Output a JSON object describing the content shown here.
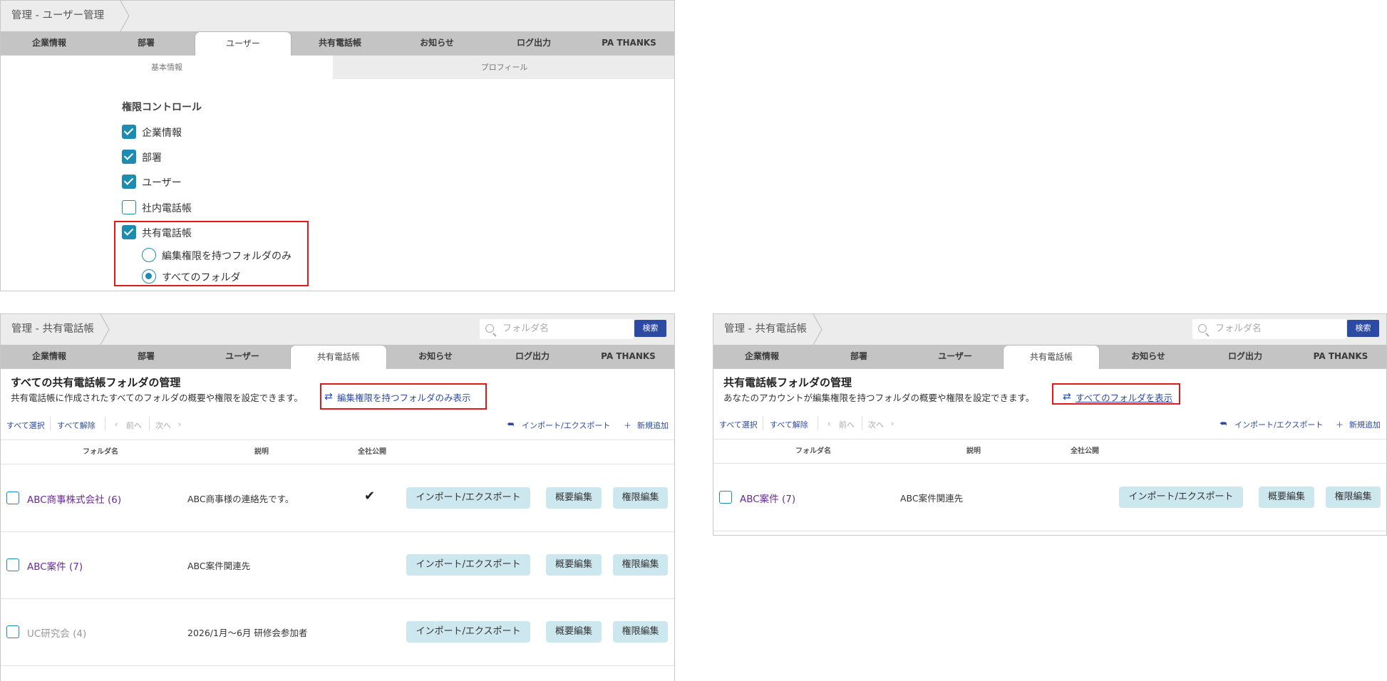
{
  "tab_labels": [
    "企業情報",
    "部署",
    "ユーザー",
    "共有電話帳",
    "お知らせ",
    "ログ出力",
    "PA THANKS"
  ],
  "panel1": {
    "breadcrumb": "管理 - ユーザー管理",
    "subtabs": [
      "基本情報",
      "プロフィール"
    ],
    "perm_title": "権限コントロール",
    "perms": [
      {
        "label": "企業情報",
        "checked": true
      },
      {
        "label": "部署",
        "checked": true
      },
      {
        "label": "ユーザー",
        "checked": true
      },
      {
        "label": "社内電話帳",
        "checked": false
      },
      {
        "label": "共有電話帳",
        "checked": true
      }
    ],
    "radios": [
      {
        "label": "編集権限を持つフォルダのみ",
        "selected": false
      },
      {
        "label": "すべてのフォルダ",
        "selected": true
      }
    ]
  },
  "panel2": {
    "breadcrumb": "管理 - 共有電話帳",
    "search_placeholder": "フォルダ名",
    "search_button": "検索",
    "title": "すべての共有電話帳フォルダの管理",
    "desc": "共有電話帳に作成されたすべてのフォルダの概要や権限を設定できます。",
    "link": "編集権限を持つフォルダのみ表示",
    "toolbar": {
      "select_all": "すべて選択",
      "deselect_all": "すべて解除",
      "prev": "前へ",
      "next": "次へ",
      "import_export": "インポート/エクスポート",
      "add_new": "新規追加"
    },
    "columns": [
      "フォルダ名",
      "説明",
      "全社公開"
    ],
    "rows": [
      {
        "name": "ABC商事株式会社 (6)",
        "desc": "ABC商事様の連絡先です。",
        "public": "✔",
        "name_gray": false
      },
      {
        "name": "ABC案件 (7)",
        "desc": "ABC案件関連先",
        "public": "",
        "name_gray": false
      },
      {
        "name": "UC研究会 (4)",
        "desc": "2026/1月～6月 研修会参加者",
        "public": "",
        "name_gray": true
      }
    ],
    "row_buttons": [
      "インポート/エクスポート",
      "概要編集",
      "権限編集"
    ]
  },
  "panel3": {
    "breadcrumb": "管理 - 共有電話帳",
    "search_placeholder": "フォルダ名",
    "search_button": "検索",
    "title": "共有電話帳フォルダの管理",
    "desc": "あなたのアカウントが編集権限を持つフォルダの概要や権限を設定できます。",
    "link": "すべてのフォルダを表示",
    "toolbar": {
      "select_all": "すべて選択",
      "deselect_all": "すべて解除",
      "prev": "前へ",
      "next": "次へ",
      "import_export": "インポート/エクスポート",
      "add_new": "新規追加"
    },
    "columns": [
      "フォルダ名",
      "説明",
      "全社公開"
    ],
    "rows": [
      {
        "name": "ABC案件 (7)",
        "desc": "ABC案件関連先",
        "public": "",
        "name_gray": false
      }
    ],
    "row_buttons": [
      "インポート/エクスポート",
      "概要編集",
      "権限編集"
    ]
  },
  "colors": {
    "accent": "#1e8bb0",
    "link": "#2c4aa2",
    "highlight": "#e01818",
    "folder_name": "#6a2a98",
    "button_bg": "#cde7ef"
  }
}
